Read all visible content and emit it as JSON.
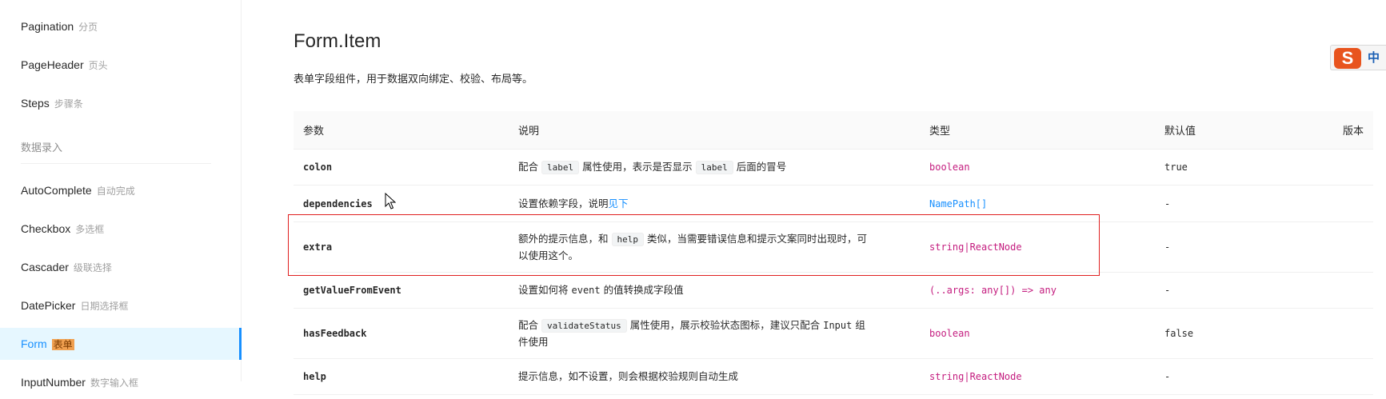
{
  "sidebar": {
    "items_top": [
      {
        "label": "Pagination",
        "zh": "分页"
      },
      {
        "label": "PageHeader",
        "zh": "页头"
      },
      {
        "label": "Steps",
        "zh": "步骤条"
      }
    ],
    "group_label": "数据录入",
    "items": [
      {
        "label": "AutoComplete",
        "zh": "自动完成"
      },
      {
        "label": "Checkbox",
        "zh": "多选框"
      },
      {
        "label": "Cascader",
        "zh": "级联选择"
      },
      {
        "label": "DatePicker",
        "zh": "日期选择框"
      },
      {
        "label": "Form",
        "zh": "表单"
      },
      {
        "label": "InputNumber",
        "zh": "数字输入框"
      }
    ]
  },
  "page": {
    "title": "Form.Item",
    "description": "表单字段组件，用于数据双向绑定、校验、布局等。"
  },
  "table": {
    "headers": [
      "参数",
      "说明",
      "类型",
      "默认值",
      "版本"
    ],
    "rows": [
      {
        "param": "colon",
        "desc_pre": "配合",
        "code1": "label",
        "desc_mid": "属性使用，表示是否显示",
        "code2": "label",
        "desc_post": "后面的冒号",
        "type": "boolean",
        "default": "true"
      },
      {
        "param": "dependencies",
        "desc": "设置依赖字段，说明",
        "link": "见下",
        "type": "NamePath[]",
        "default": "-"
      },
      {
        "param": "extra",
        "desc_pre": "额外的提示信息，和",
        "code1": "help",
        "desc_line1_post": "类似，当需要错误信息和提示文案同时出现时，可",
        "desc_line2": "以使用这个。",
        "type": "string|ReactNode",
        "default": "-"
      },
      {
        "param": "getValueFromEvent",
        "desc_pre": "设置如何将",
        "inline_code": "event",
        "desc_post": "的值转换成字段值",
        "type": "(..args: any[]) => any",
        "default": "-"
      },
      {
        "param": "hasFeedback",
        "desc_pre": "配合",
        "code1": "validateStatus",
        "desc_mid": "属性使用，展示校验状态图标，建议只配合",
        "inline_code": "Input",
        "desc_post": "组",
        "desc_line2": "件使用",
        "type": "boolean",
        "default": "false"
      },
      {
        "param": "help",
        "desc": "提示信息，如不设置，则会根据校验规则自动生成",
        "type": "string|ReactNode",
        "default": "-"
      }
    ]
  },
  "ime": {
    "logo": "S",
    "mode": "中"
  },
  "colors": {
    "accent": "#1890ff",
    "type": "#c41d7f",
    "highlight": "#e02020",
    "active_bg": "#e6f7ff"
  }
}
